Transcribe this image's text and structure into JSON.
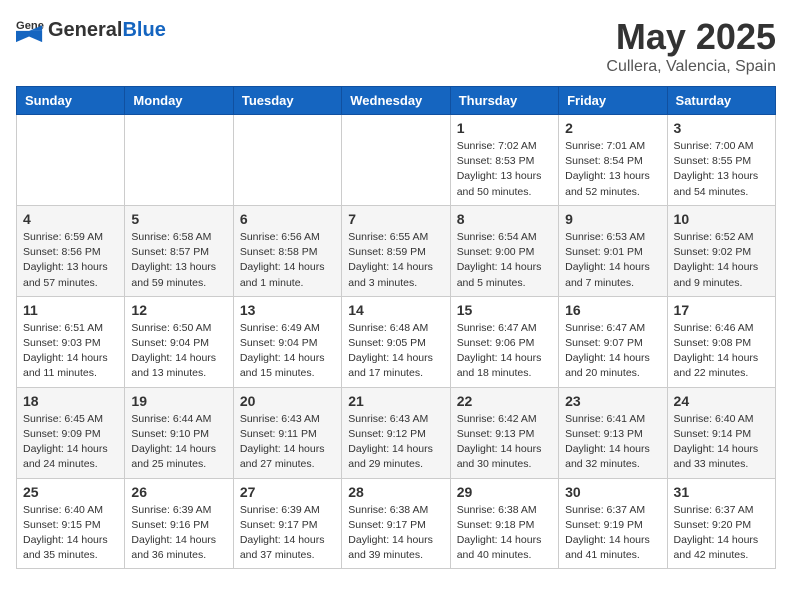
{
  "header": {
    "logo_general": "General",
    "logo_blue": "Blue",
    "month_title": "May 2025",
    "location": "Cullera, Valencia, Spain"
  },
  "calendar": {
    "weekdays": [
      "Sunday",
      "Monday",
      "Tuesday",
      "Wednesday",
      "Thursday",
      "Friday",
      "Saturday"
    ],
    "weeks": [
      [
        {
          "day": "",
          "info": ""
        },
        {
          "day": "",
          "info": ""
        },
        {
          "day": "",
          "info": ""
        },
        {
          "day": "",
          "info": ""
        },
        {
          "day": "1",
          "info": "Sunrise: 7:02 AM\nSunset: 8:53 PM\nDaylight: 13 hours\nand 50 minutes."
        },
        {
          "day": "2",
          "info": "Sunrise: 7:01 AM\nSunset: 8:54 PM\nDaylight: 13 hours\nand 52 minutes."
        },
        {
          "day": "3",
          "info": "Sunrise: 7:00 AM\nSunset: 8:55 PM\nDaylight: 13 hours\nand 54 minutes."
        }
      ],
      [
        {
          "day": "4",
          "info": "Sunrise: 6:59 AM\nSunset: 8:56 PM\nDaylight: 13 hours\nand 57 minutes."
        },
        {
          "day": "5",
          "info": "Sunrise: 6:58 AM\nSunset: 8:57 PM\nDaylight: 13 hours\nand 59 minutes."
        },
        {
          "day": "6",
          "info": "Sunrise: 6:56 AM\nSunset: 8:58 PM\nDaylight: 14 hours\nand 1 minute."
        },
        {
          "day": "7",
          "info": "Sunrise: 6:55 AM\nSunset: 8:59 PM\nDaylight: 14 hours\nand 3 minutes."
        },
        {
          "day": "8",
          "info": "Sunrise: 6:54 AM\nSunset: 9:00 PM\nDaylight: 14 hours\nand 5 minutes."
        },
        {
          "day": "9",
          "info": "Sunrise: 6:53 AM\nSunset: 9:01 PM\nDaylight: 14 hours\nand 7 minutes."
        },
        {
          "day": "10",
          "info": "Sunrise: 6:52 AM\nSunset: 9:02 PM\nDaylight: 14 hours\nand 9 minutes."
        }
      ],
      [
        {
          "day": "11",
          "info": "Sunrise: 6:51 AM\nSunset: 9:03 PM\nDaylight: 14 hours\nand 11 minutes."
        },
        {
          "day": "12",
          "info": "Sunrise: 6:50 AM\nSunset: 9:04 PM\nDaylight: 14 hours\nand 13 minutes."
        },
        {
          "day": "13",
          "info": "Sunrise: 6:49 AM\nSunset: 9:04 PM\nDaylight: 14 hours\nand 15 minutes."
        },
        {
          "day": "14",
          "info": "Sunrise: 6:48 AM\nSunset: 9:05 PM\nDaylight: 14 hours\nand 17 minutes."
        },
        {
          "day": "15",
          "info": "Sunrise: 6:47 AM\nSunset: 9:06 PM\nDaylight: 14 hours\nand 18 minutes."
        },
        {
          "day": "16",
          "info": "Sunrise: 6:47 AM\nSunset: 9:07 PM\nDaylight: 14 hours\nand 20 minutes."
        },
        {
          "day": "17",
          "info": "Sunrise: 6:46 AM\nSunset: 9:08 PM\nDaylight: 14 hours\nand 22 minutes."
        }
      ],
      [
        {
          "day": "18",
          "info": "Sunrise: 6:45 AM\nSunset: 9:09 PM\nDaylight: 14 hours\nand 24 minutes."
        },
        {
          "day": "19",
          "info": "Sunrise: 6:44 AM\nSunset: 9:10 PM\nDaylight: 14 hours\nand 25 minutes."
        },
        {
          "day": "20",
          "info": "Sunrise: 6:43 AM\nSunset: 9:11 PM\nDaylight: 14 hours\nand 27 minutes."
        },
        {
          "day": "21",
          "info": "Sunrise: 6:43 AM\nSunset: 9:12 PM\nDaylight: 14 hours\nand 29 minutes."
        },
        {
          "day": "22",
          "info": "Sunrise: 6:42 AM\nSunset: 9:13 PM\nDaylight: 14 hours\nand 30 minutes."
        },
        {
          "day": "23",
          "info": "Sunrise: 6:41 AM\nSunset: 9:13 PM\nDaylight: 14 hours\nand 32 minutes."
        },
        {
          "day": "24",
          "info": "Sunrise: 6:40 AM\nSunset: 9:14 PM\nDaylight: 14 hours\nand 33 minutes."
        }
      ],
      [
        {
          "day": "25",
          "info": "Sunrise: 6:40 AM\nSunset: 9:15 PM\nDaylight: 14 hours\nand 35 minutes."
        },
        {
          "day": "26",
          "info": "Sunrise: 6:39 AM\nSunset: 9:16 PM\nDaylight: 14 hours\nand 36 minutes."
        },
        {
          "day": "27",
          "info": "Sunrise: 6:39 AM\nSunset: 9:17 PM\nDaylight: 14 hours\nand 37 minutes."
        },
        {
          "day": "28",
          "info": "Sunrise: 6:38 AM\nSunset: 9:17 PM\nDaylight: 14 hours\nand 39 minutes."
        },
        {
          "day": "29",
          "info": "Sunrise: 6:38 AM\nSunset: 9:18 PM\nDaylight: 14 hours\nand 40 minutes."
        },
        {
          "day": "30",
          "info": "Sunrise: 6:37 AM\nSunset: 9:19 PM\nDaylight: 14 hours\nand 41 minutes."
        },
        {
          "day": "31",
          "info": "Sunrise: 6:37 AM\nSunset: 9:20 PM\nDaylight: 14 hours\nand 42 minutes."
        }
      ]
    ]
  }
}
